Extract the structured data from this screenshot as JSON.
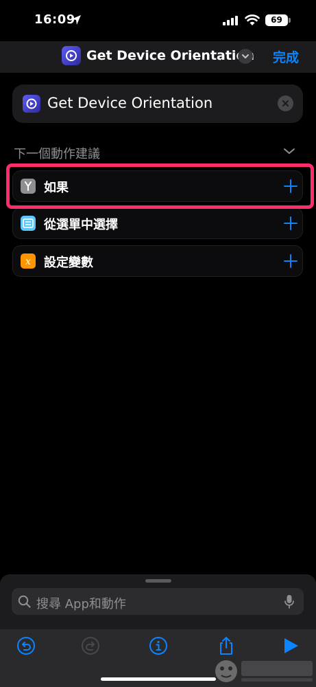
{
  "status_bar": {
    "time": "16:09",
    "battery": "69"
  },
  "nav": {
    "title": "Get Device Orientation",
    "done_label": "完成"
  },
  "action_card": {
    "title": "Get Device Orientation"
  },
  "suggestions": {
    "header": "下一個動作建議",
    "items": [
      {
        "label": "如果",
        "icon": "if-branch-icon",
        "color": "#8e8e93"
      },
      {
        "label": "從選單中選擇",
        "icon": "menu-list-icon",
        "color": "#5ac8fa"
      },
      {
        "label": "設定變數",
        "icon": "variable-x-icon",
        "color": "#ff9500"
      }
    ]
  },
  "search": {
    "placeholder": "搜尋 App和動作"
  },
  "toolbar": {
    "buttons": [
      "undo-icon",
      "redo-icon",
      "info-icon",
      "share-icon",
      "play-icon"
    ]
  },
  "colors": {
    "accent": "#0a84ff",
    "highlight": "#ff2d6a"
  }
}
